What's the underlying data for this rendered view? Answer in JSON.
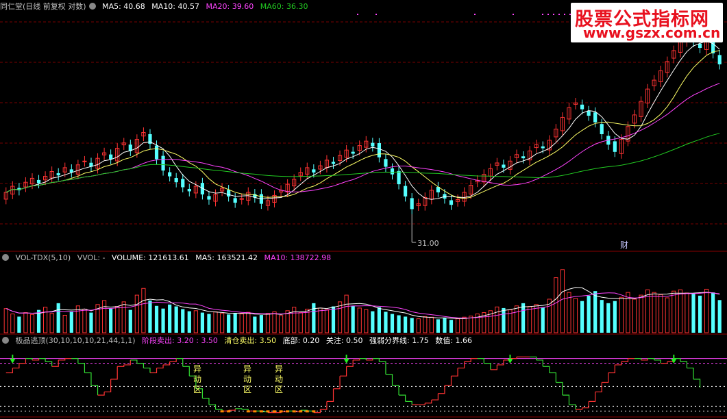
{
  "panel1": {
    "title": "同仁堂(日线 前复权 对数)",
    "ma5_label": "MA5: 40.68",
    "ma10_label": "MA10: 40.57",
    "ma20_label": "MA20: 39.60",
    "ma60_label": "MA60: 36.30",
    "low_marker": "31.00",
    "fin_marker": "财",
    "colors": {
      "ma5": "#ffffff",
      "ma10": "#ffff66",
      "ma20": "#ff44ff",
      "ma60": "#22cc22",
      "up": "#ff3333",
      "down": "#55ffff"
    }
  },
  "panel2": {
    "title": "VOL-TDX(5,10)",
    "vvol": "VVOL: -",
    "volume": "VOLUME: 121613.61",
    "ma5": "MA5: 163521.42",
    "ma10": "MA10: 138722.98"
  },
  "panel3": {
    "title": "极品逃顶(30,10,10,10,21,44,1,1)",
    "stage_sell": "阶段卖出: 3.20 : 3.50",
    "clear_sell": "清仓卖出: 3.50",
    "bottom": "底部: 0.20",
    "watch": "关注: 0.50",
    "divider": "强弱分界线: 1.75",
    "value": "数值: 1.66",
    "annot": "异动区"
  },
  "watermark": {
    "line1": "股票公式指标网",
    "line2": "www.gszx.com.cn"
  },
  "chart_data": [
    {
      "type": "candlestick",
      "title": "同仁堂(日线 前复权 对数)",
      "y_range": [
        28,
        56
      ],
      "close": [
        33.0,
        33.6,
        33.2,
        34.0,
        34.4,
        33.9,
        34.6,
        35.1,
        34.7,
        35.5,
        35.0,
        35.8,
        36.2,
        35.6,
        36.5,
        37.1,
        36.4,
        37.6,
        38.2,
        37.3,
        38.6,
        39.4,
        38.1,
        36.4,
        35.2,
        34.6,
        34.0,
        33.5,
        33.1,
        33.6,
        32.8,
        32.3,
        32.8,
        33.4,
        32.6,
        32.0,
        32.4,
        33.0,
        32.5,
        31.9,
        32.2,
        32.7,
        33.2,
        33.8,
        34.3,
        35.0,
        35.5,
        35.0,
        35.7,
        36.3,
        35.9,
        36.8,
        37.4,
        37.0,
        37.9,
        38.4,
        37.8,
        36.6,
        35.6,
        34.8,
        33.8,
        32.6,
        31.4,
        31.9,
        32.5,
        33.2,
        33.0,
        32.4,
        31.8,
        32.3,
        33.0,
        33.7,
        34.2,
        34.8,
        35.4,
        36.0,
        35.5,
        36.2,
        36.9,
        36.5,
        37.3,
        38.0,
        37.6,
        38.5,
        39.8,
        41.2,
        42.4,
        43.0,
        42.2,
        41.4,
        40.6,
        39.2,
        38.0,
        37.2,
        38.6,
        40.1,
        41.5,
        43.2,
        44.8,
        46.0,
        47.3,
        48.6,
        50.2,
        51.8,
        52.4,
        51.5,
        50.6,
        51.9,
        49.8,
        48.2
      ],
      "annotations": [
        "31.00",
        "财"
      ]
    },
    {
      "type": "bar",
      "title": "VOL-TDX(5,10)",
      "y_range": [
        0,
        260000
      ],
      "values": [
        90000,
        70000,
        60000,
        75000,
        68000,
        85000,
        95000,
        72000,
        110000,
        65000,
        80000,
        100000,
        88000,
        75000,
        105000,
        120000,
        90000,
        98000,
        115000,
        85000,
        140000,
        165000,
        120000,
        100000,
        90000,
        105000,
        98000,
        88000,
        80000,
        82000,
        75000,
        70000,
        78000,
        72000,
        68000,
        74000,
        70000,
        76000,
        60000,
        66000,
        72000,
        78000,
        64000,
        82000,
        95000,
        75000,
        88000,
        110000,
        92000,
        86000,
        98000,
        115000,
        140000,
        100000,
        92000,
        86000,
        80000,
        95000,
        78000,
        70000,
        65000,
        60000,
        55000,
        52000,
        60000,
        58000,
        50000,
        56000,
        48000,
        52000,
        58000,
        62000,
        70000,
        75000,
        82000,
        96000,
        92000,
        85000,
        100000,
        110000,
        98000,
        105000,
        95000,
        125000,
        205000,
        235000,
        150000,
        128000,
        118000,
        138000,
        155000,
        122000,
        110000,
        118000,
        132000,
        150000,
        125000,
        140000,
        160000,
        150000,
        142000,
        130000,
        155000,
        160000,
        148000,
        145000,
        138000,
        162000,
        150000,
        121613.61
      ],
      "series": [
        {
          "name": "MA5",
          "values": [
            null,
            null,
            null,
            null,
            72600,
            71600,
            76600,
            79000,
            86000,
            85400,
            84400,
            84400,
            88600,
            81600,
            89600,
            97600,
            95600,
            95200,
            105600,
            101600,
            109600,
            120600,
            125600,
            126000,
            123000,
            123000,
            104600,
            94200,
            90200,
            88600,
            84600,
            79000,
            77000,
            75400,
            72600,
            72000,
            72400,
            72000,
            69600,
            69200,
            68800,
            70400,
            68000,
            72400,
            78200,
            78800,
            80800,
            90000,
            92000,
            90200,
            93800,
            98200,
            110200,
            107600,
            104200,
            106600,
            103200,
            100600,
            86200,
            81800,
            77600,
            73600,
            69600,
            60400,
            58000,
            57000,
            55200,
            55200,
            53000,
            52800,
            52400,
            55200,
            58000,
            62400,
            69400,
            77000,
            80400,
            84600,
            87000,
            91800,
            95000,
            99800,
            99800,
            104200,
            129600,
            153000,
            163000,
            168600,
            167200,
            154600,
            137800,
            133000,
            136800,
            128600,
            127400,
            126200,
            127000,
            129600,
            134200,
            145400,
            145400,
            143400,
            145400,
            146200,
            147000,
            149600,
            149800,
            150600,
            146200,
            143350
          ],
          "note": "MA5 overlay"
        },
        {
          "name": "MA10",
          "values": []
        }
      ]
    },
    {
      "type": "line",
      "title": "极品逃顶(30,10,10,10,21,44,1,1)",
      "y_range": [
        0,
        4
      ],
      "series": [
        {
          "name": "数值",
          "values": [
            2.6,
            2.9,
            3.2,
            3.5,
            3.4,
            3.5,
            3.3,
            3.0,
            3.4,
            3.5,
            3.5,
            3.2,
            2.6,
            1.8,
            1.2,
            1.4,
            2.2,
            3.0,
            3.1,
            3.4,
            3.2,
            2.9,
            2.6,
            2.9,
            3.1,
            3.3,
            3.5,
            3.0,
            2.4,
            1.6,
            1.0,
            0.6,
            0.3,
            0.2,
            0.25,
            0.35,
            0.3,
            0.2,
            0.2,
            0.15,
            0.1,
            0.1,
            0.15,
            0.2,
            0.15,
            0.25,
            0.2,
            0.1,
            0.3,
            0.8,
            1.6,
            2.4,
            3.0,
            3.4,
            3.5,
            3.4,
            3.5,
            3.3,
            2.5,
            1.8,
            1.2,
            0.8,
            0.6,
            0.6,
            0.7,
            0.9,
            1.3,
            1.8,
            2.4,
            2.9,
            3.3,
            3.5,
            3.5,
            3.2,
            2.8,
            3.1,
            3.4,
            3.5,
            3.6,
            3.6,
            3.6,
            3.4,
            3.0,
            2.6,
            2.0,
            1.2,
            0.6,
            0.3,
            0.4,
            0.8,
            1.4,
            2.0,
            2.6,
            3.1,
            3.3,
            3.5,
            3.5,
            3.4,
            3.5,
            3.4,
            3.2,
            3.3,
            3.5,
            3.3,
            2.9,
            2.2,
            1.66
          ]
        }
      ],
      "annotations": [
        "异动区",
        "异动区",
        "异动区"
      ]
    }
  ]
}
